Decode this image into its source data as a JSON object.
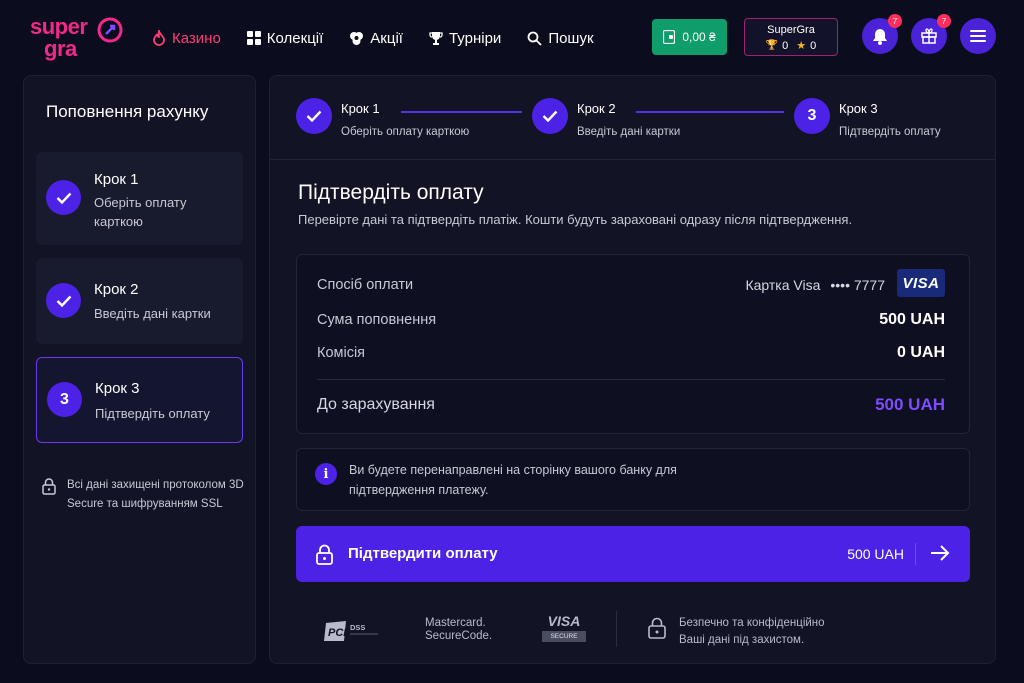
{
  "header": {
    "logo_top": "super",
    "logo_bottom": "gra",
    "nav": [
      {
        "label": "Казино",
        "icon": "flame-icon",
        "active": true
      },
      {
        "label": "Колекції",
        "icon": "grid-icon",
        "active": false
      },
      {
        "label": "Акції",
        "icon": "promo-icon",
        "active": false
      },
      {
        "label": "Турніри",
        "icon": "trophy-icon",
        "active": false
      },
      {
        "label": "Пошук",
        "icon": "search-icon",
        "active": false
      }
    ],
    "balance": "0,00 ₴",
    "profile": {
      "name": "SuperGra",
      "trophies": "0",
      "stars": "0"
    },
    "notifications_count": "7",
    "gifts_count": "7"
  },
  "sidebar": {
    "title": "Поповнення рахунку",
    "steps": [
      {
        "title": "Крок 1",
        "subtitle": "Оберіть оплату карткою",
        "done": true
      },
      {
        "title": "Крок 2",
        "subtitle": "Введіть дані картки",
        "done": true
      },
      {
        "title": "Крок 3",
        "subtitle": "Підтвердіть оплату",
        "number": "3",
        "active": true
      }
    ],
    "security_note": "Всі дані захищені протоколом 3D Secure та шифруванням SSL"
  },
  "stepper": [
    {
      "title": "Крок 1",
      "subtitle": "Оберіть оплату карткою"
    },
    {
      "title": "Крок 2",
      "subtitle": "Введіть дані картки"
    },
    {
      "title": "Крок 3",
      "subtitle": "Підтвердіть оплату",
      "number": "3"
    }
  ],
  "main": {
    "title": "Підтвердіть оплату",
    "subtitle": "Перевірте дані та підтвердіть платіж. Кошти будуть зараховані одразу після підтвердження.",
    "summary": {
      "method_label": "Спосіб оплати",
      "method_value": "Картка Visa",
      "card_mask": "•••• 7777",
      "card_brand": "VISA",
      "amount_label": "Сума поповнення",
      "amount_value": "500 UAH",
      "fee_label": "Комісія",
      "fee_value": "0 UAH",
      "total_label": "До зарахування",
      "total_value": "500 UAH"
    },
    "info_text": "Ви будете перенаправлені на сторінку вашого банку для підтвердження платежу.",
    "confirm": {
      "label": "Підтвердити оплату",
      "amount": "500 UAH"
    },
    "footer": {
      "pci": "PCI DSS",
      "mastercard_line1": "Mastercard.",
      "mastercard_line2": "SecureCode.",
      "visa": "VISA",
      "visa_secure": "SECURE",
      "secure_line1": "Безпечно та конфіденційно",
      "secure_line2": "Ваші дані під захистом."
    }
  },
  "colors": {
    "accent": "#4c23e6",
    "active_nav": "#ff3d74",
    "balance": "#0f9d6c",
    "total": "#7c4dff",
    "background": "#0b0c1d"
  }
}
